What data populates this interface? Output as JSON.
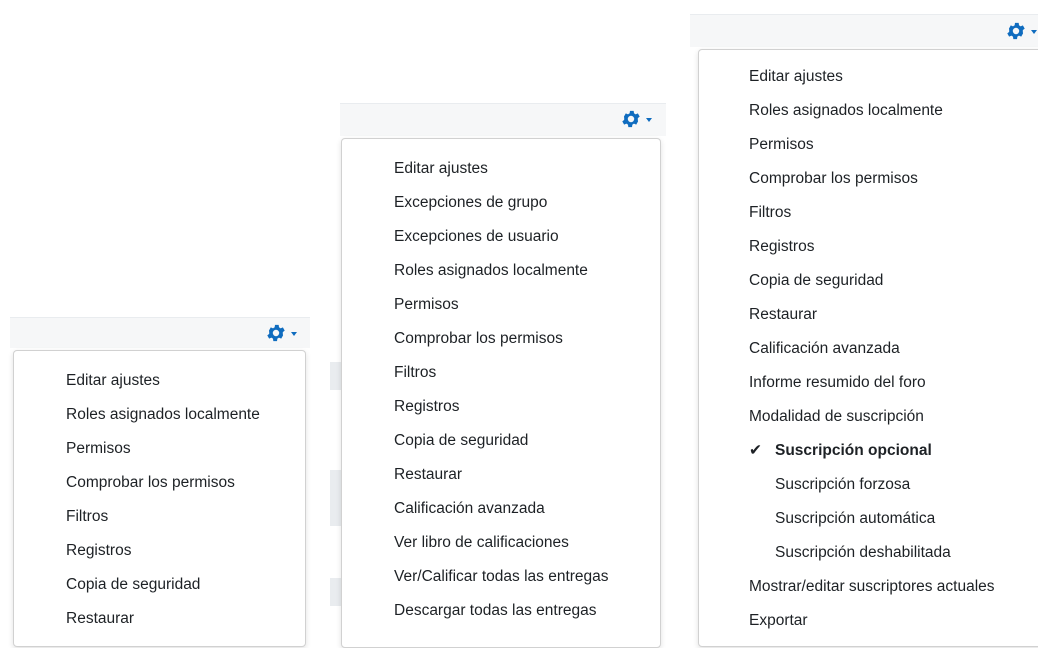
{
  "menus": [
    {
      "items": [
        "Editar ajustes",
        "Roles asignados localmente",
        "Permisos",
        "Comprobar los permisos",
        "Filtros",
        "Registros",
        "Copia de seguridad",
        "Restaurar"
      ]
    },
    {
      "items": [
        "Editar ajustes",
        "Excepciones de grupo",
        "Excepciones de usuario",
        "Roles asignados localmente",
        "Permisos",
        "Comprobar los permisos",
        "Filtros",
        "Registros",
        "Copia de seguridad",
        "Restaurar",
        "Calificación avanzada",
        "Ver libro de calificaciones",
        "Ver/Calificar todas las entregas",
        "Descargar todas las entregas"
      ]
    },
    {
      "items": [
        "Editar ajustes",
        "Roles asignados localmente",
        "Permisos",
        "Comprobar los permisos",
        "Filtros",
        "Registros",
        "Copia de seguridad",
        "Restaurar",
        "Calificación avanzada",
        "Informe resumido del foro",
        "Modalidad de suscripción",
        "Suscripción opcional",
        "Suscripción forzosa",
        "Suscripción automática",
        "Suscripción deshabilitada",
        "Mostrar/editar suscriptores actuales",
        "Exportar"
      ],
      "checkmark": "✔"
    }
  ],
  "icons": {
    "gear": "gear-icon",
    "caret": "caret-down-icon"
  },
  "colors": {
    "accent": "#0f6cbf",
    "text": "#1d2125"
  }
}
